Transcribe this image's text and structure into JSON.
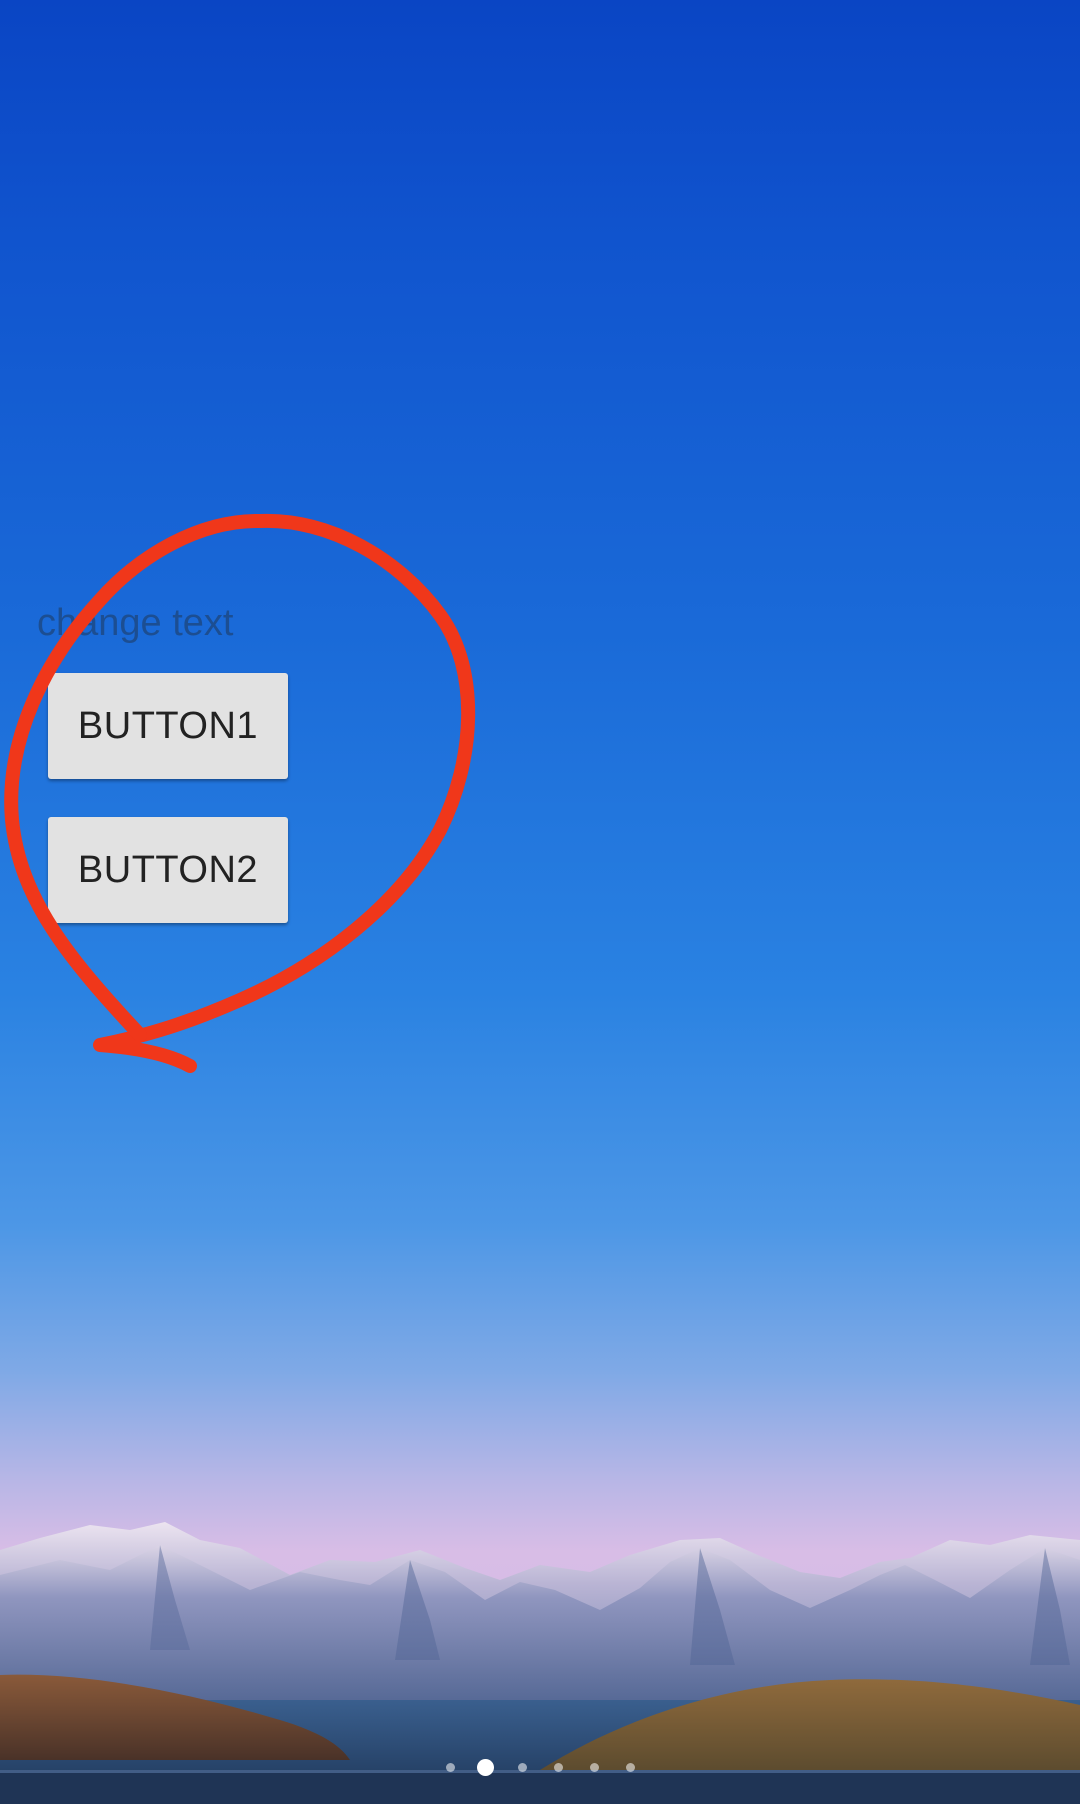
{
  "widget": {
    "label": "change text",
    "button1_label": "BUTTON1",
    "button2_label": "BUTTON2"
  },
  "wallpaper": {
    "sky_top_color": "#0a45c4",
    "sky_horizon_color": "#d8bde6",
    "annotation_color": "#f0371a"
  },
  "page_indicator": {
    "count": 6,
    "active_index": 1
  }
}
